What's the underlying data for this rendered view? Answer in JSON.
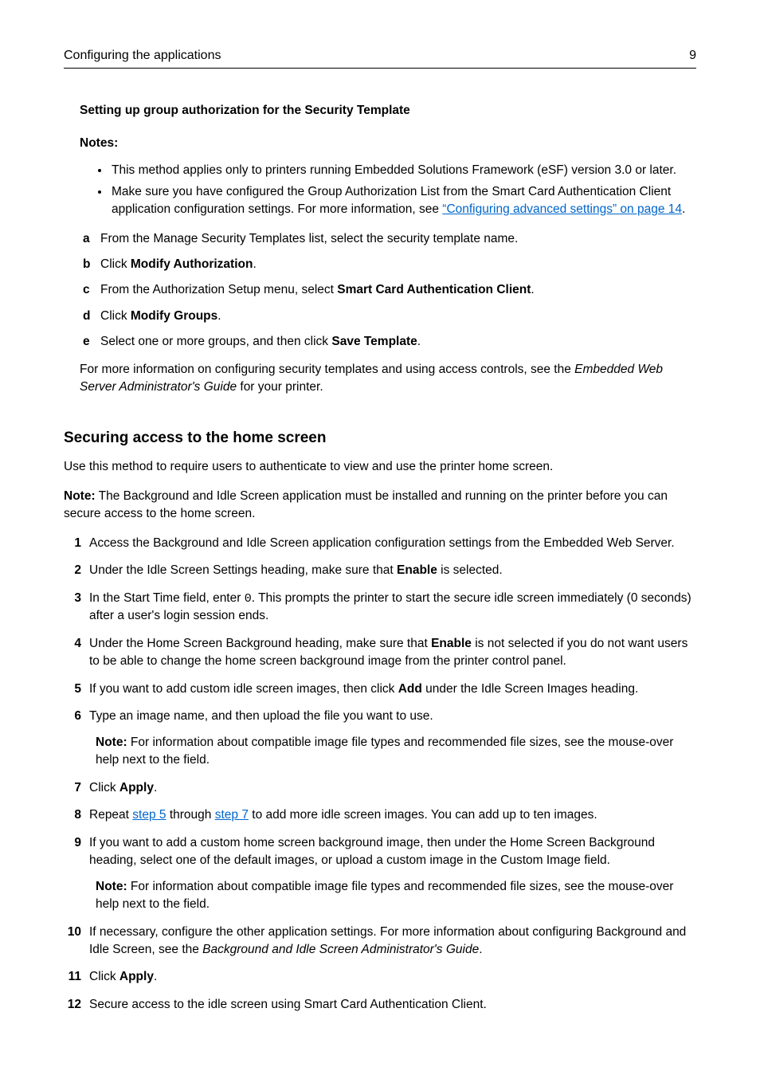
{
  "header": {
    "section_title": "Configuring the applications",
    "page_number": "9"
  },
  "h_sub1": "Setting up group authorization for the Security Template",
  "notes_label": "Notes:",
  "notes": {
    "n1": "This method applies only to printers running Embedded Solutions Framework (eSF) version 3.0 or later.",
    "n2_pre": "Make sure you have configured the Group Authorization List from the Smart Card Authentication Client application configuration settings. For more information, see ",
    "n2_link": "“Configuring advanced settings” on page 14",
    "n2_post": "."
  },
  "letters": {
    "a": "From the Manage Security Templates list, select the security template name.",
    "b_pre": "Click ",
    "b_bold": "Modify Authorization",
    "b_post": ".",
    "c_pre": "From the Authorization Setup menu, select ",
    "c_bold": "Smart Card Authentication Client",
    "c_post": ".",
    "d_pre": "Click ",
    "d_bold": "Modify Groups",
    "d_post": ".",
    "e_pre": "Select one or more groups, and then click ",
    "e_bold": "Save Template",
    "e_post": "."
  },
  "after_letters": {
    "pre": "For more information on configuring security templates and using access controls, see the ",
    "ital": "Embedded Web Server Administrator's Guide",
    "post": " for your printer."
  },
  "h_section": "Securing access to the home screen",
  "intro": "Use this method to require users to authenticate to view and use the printer home screen.",
  "note_intro": {
    "label": "Note:",
    "text": " The Background and Idle Screen application must be installed and running on the printer before you can secure access to the home screen."
  },
  "steps": {
    "s1": "Access the Background and Idle Screen application configuration settings from the Embedded Web Server.",
    "s2_pre": "Under the Idle Screen Settings heading, make sure that ",
    "s2_bold": "Enable",
    "s2_post": " is selected.",
    "s3_pre": "In the Start Time field, enter ",
    "s3_mono": "0",
    "s3_post": ". This prompts the printer to start the secure idle screen immediately (0 seconds) after a user's login session ends.",
    "s4_pre": "Under the Home Screen Background heading, make sure that ",
    "s4_bold": "Enable",
    "s4_post": " is not selected if you do not want users to be able to change the home screen background image from the printer control panel.",
    "s5_pre": "If you want to add custom idle screen images, then click ",
    "s5_bold": "Add",
    "s5_post": " under the Idle Screen Images heading.",
    "s6": "Type an image name, and then upload the file you want to use.",
    "s6_note_label": "Note:",
    "s6_note": " For information about compatible image file types and recommended file sizes, see the mouse-over help next to the field.",
    "s7_pre": "Click ",
    "s7_bold": "Apply",
    "s7_post": ".",
    "s8_pre": "Repeat ",
    "s8_link1": "step 5",
    "s8_mid": " through ",
    "s8_link2": "step 7",
    "s8_post": " to add more idle screen images. You can add up to ten images.",
    "s9": "If you want to add a custom home screen background image, then under the Home Screen Background heading, select one of the default images, or upload a custom image in the Custom Image field.",
    "s9_note_label": "Note:",
    "s9_note": " For information about compatible image file types and recommended file sizes, see the mouse-over help next to the field.",
    "s10_pre": "If necessary, configure the other application settings. For more information about configuring Background and Idle Screen, see the ",
    "s10_ital": "Background and Idle Screen Administrator's Guide",
    "s10_post": ".",
    "s11_pre": "Click ",
    "s11_bold": "Apply",
    "s11_post": ".",
    "s12": "Secure access to the idle screen using Smart Card Authentication Client."
  }
}
